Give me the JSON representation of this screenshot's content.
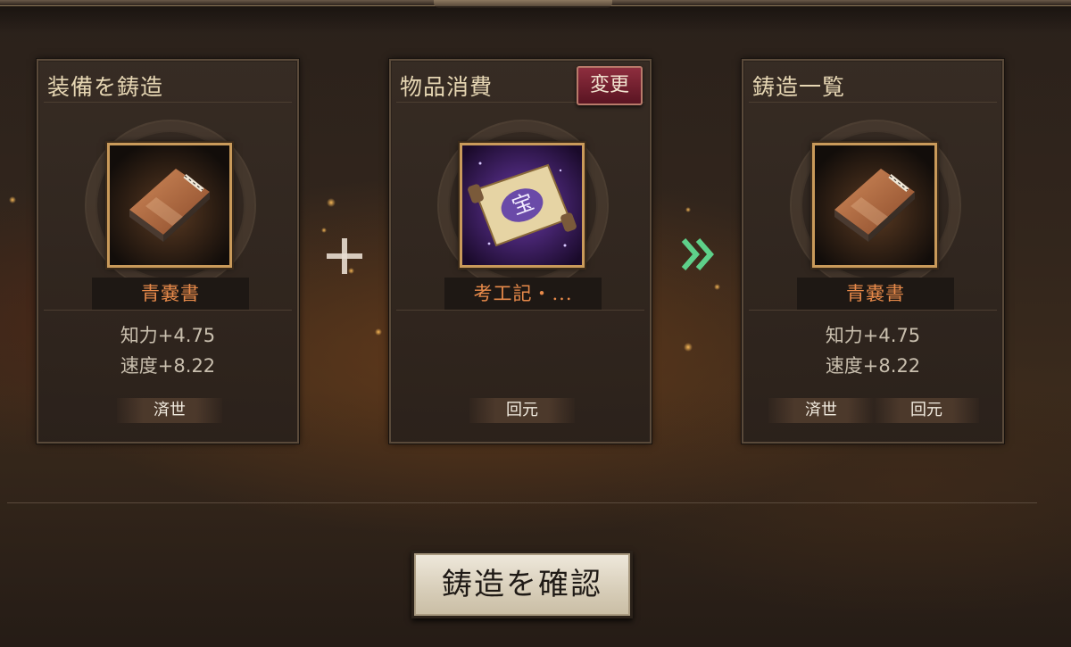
{
  "panels": {
    "equip": {
      "title": "装備を鋳造",
      "item_name": "青嚢書",
      "stats": [
        "知力+4.75",
        "速度+8.22"
      ],
      "tags": [
        "済世"
      ]
    },
    "consume": {
      "title": "物品消費",
      "change_label": "変更",
      "item_name": "考工記・...",
      "scroll_glyph": "宝",
      "tags": [
        "回元"
      ]
    },
    "result": {
      "title": "鋳造一覧",
      "item_name": "青嚢書",
      "stats": [
        "知力+4.75",
        "速度+8.22"
      ],
      "tags": [
        "済世",
        "回元"
      ]
    }
  },
  "confirm_label": "鋳造を確認",
  "icons": {
    "plus": "plus-icon",
    "arrow": "double-chevron-right-icon",
    "book": "book-icon",
    "scroll": "scroll-icon"
  },
  "colors": {
    "item_name": "#e88a4a",
    "change_button": "#7a2232",
    "arrow": "#5ed08a"
  }
}
